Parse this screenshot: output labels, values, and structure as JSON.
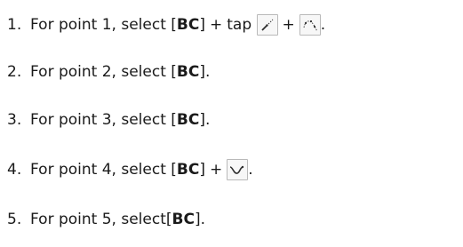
{
  "steps": [
    {
      "number": "1.",
      "text": "For point 1, select",
      "code": "BC",
      "sep": " ",
      "icons": [
        "point-tangent-icon",
        "curve-through-points-icon"
      ],
      "end": "."
    },
    {
      "number": "2.",
      "text": "For point 2, select",
      "code": "BC",
      "sep": " ",
      "icons": [],
      "end": "."
    },
    {
      "number": "3.",
      "text": "For point 3, select",
      "code": "BC",
      "sep": " ",
      "icons": [],
      "end": "."
    },
    {
      "number": "4.",
      "text": "For point 4, select",
      "code": "BC",
      "sep": " ",
      "icons": [
        "curve-segment-icon"
      ],
      "end": "."
    },
    {
      "number": "5.",
      "text": "For point 5, select",
      "code": "BC",
      "sep": "",
      "icons": [],
      "end": "."
    }
  ],
  "connectors": {
    "tap": "tap",
    "plus": "+"
  },
  "colors": {
    "icon_fill": "#f7f7f7",
    "icon_border": "#b9b9b9",
    "icon_stroke": "#2f2f2f"
  }
}
